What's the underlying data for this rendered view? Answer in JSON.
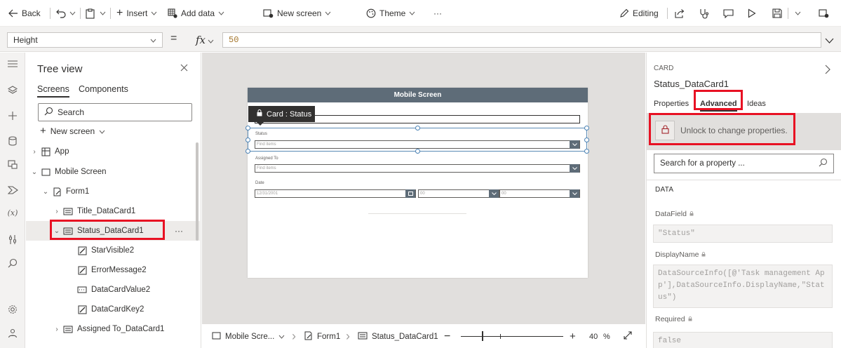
{
  "toolbar": {
    "back": "Back",
    "insert": "Insert",
    "add_data": "Add data",
    "new_screen": "New screen",
    "theme": "Theme",
    "more": "···",
    "editing": "Editing"
  },
  "formula": {
    "property": "Height",
    "equals": "=",
    "fx": "fx",
    "value": "50"
  },
  "tree": {
    "title": "Tree view",
    "tabs": [
      "Screens",
      "Components"
    ],
    "search_placeholder": "Search",
    "new_screen": "New screen",
    "items": [
      {
        "label": "App"
      },
      {
        "label": "Mobile Screen"
      },
      {
        "label": "Form1"
      },
      {
        "label": "Title_DataCard1"
      },
      {
        "label": "Status_DataCard1"
      },
      {
        "label": "StarVisible2"
      },
      {
        "label": "ErrorMessage2"
      },
      {
        "label": "DataCardValue2"
      },
      {
        "label": "DataCardKey2"
      },
      {
        "label": "Assigned To_DataCard1"
      }
    ],
    "row_more": "···"
  },
  "canvas": {
    "screen_title": "Mobile Screen",
    "card_tooltip": "Card : Status",
    "fields": {
      "status_label": "Status",
      "status_placeholder": "Find items",
      "assigned_label": "Assigned To",
      "assigned_placeholder": "Find items",
      "date_label": "Date",
      "date_value": "12/31/2001",
      "hour_value": "00",
      "minute_value": "00"
    }
  },
  "bottom_bar": {
    "screen": "Mobile Scre...",
    "form": "Form1",
    "card": "Status_DataCard1",
    "zoom_minus": "−",
    "zoom_plus": "+",
    "zoom_value": "40",
    "zoom_unit": "%",
    "zoom_level": 0.4
  },
  "right_panel": {
    "type": "CARD",
    "name": "Status_DataCard1",
    "tabs": [
      "Properties",
      "Advanced",
      "Ideas"
    ],
    "unlock_text": "Unlock to change properties.",
    "search_placeholder": "Search for a property ...",
    "section": "DATA",
    "properties": [
      {
        "label": "DataField",
        "value": "\"Status\""
      },
      {
        "label": "DisplayName",
        "value": "DataSourceInfo([@'Task management App'],DataSourceInfo.DisplayName,\"Status\")"
      },
      {
        "label": "Required",
        "value": "false"
      }
    ]
  },
  "colors": {
    "highlight_red": "#e81123",
    "screen_header": "#5e6c78",
    "selection_blue": "#4a82b5"
  }
}
